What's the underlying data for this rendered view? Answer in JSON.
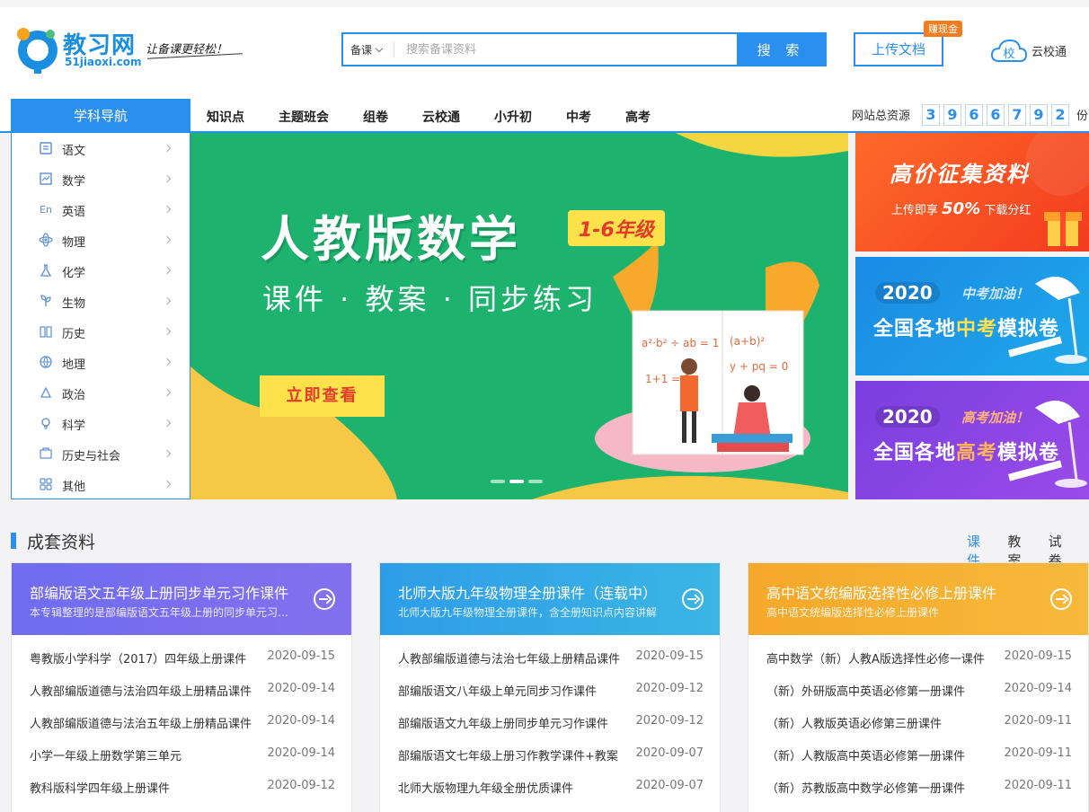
{
  "header": {
    "logo_text": "教习网",
    "logo_url": "51jiaoxi.com",
    "slogan": "让备课更轻松！",
    "search_category": "备课",
    "search_placeholder": "搜索备课资料",
    "search_button": "搜 索",
    "upload_label": "上传文档",
    "upload_badge": "赚现金",
    "cloud_icon_char": "校",
    "cloud_label": "云校通"
  },
  "nav": {
    "subject_nav": "学科导航",
    "items": [
      "知识点",
      "主题班会",
      "组卷",
      "云校通",
      "小升初",
      "中考",
      "高考"
    ],
    "total_label": "网站总资源",
    "total_digits": [
      "3",
      "9",
      "6",
      "6",
      "7",
      "9",
      "2"
    ],
    "total_unit": "份"
  },
  "sidebar": {
    "items": [
      {
        "label": "语文",
        "icon": "book-icon"
      },
      {
        "label": "数学",
        "icon": "math-icon"
      },
      {
        "label": "英语",
        "icon": "english-icon"
      },
      {
        "label": "物理",
        "icon": "atom-icon"
      },
      {
        "label": "化学",
        "icon": "flask-icon"
      },
      {
        "label": "生物",
        "icon": "plant-icon"
      },
      {
        "label": "历史",
        "icon": "history-icon"
      },
      {
        "label": "地理",
        "icon": "globe-icon"
      },
      {
        "label": "政治",
        "icon": "politics-icon"
      },
      {
        "label": "科学",
        "icon": "bulb-icon"
      },
      {
        "label": "历史与社会",
        "icon": "society-icon"
      },
      {
        "label": "其他",
        "icon": "grid-icon"
      }
    ]
  },
  "banner": {
    "title": "人教版数学",
    "tag": "1-6年级",
    "subtitle": "课件 · 教案 · 同步练习",
    "button": "立即查看",
    "board_text": [
      "a²·b² ÷ ab = 1",
      "(a+b)²",
      "1+1 = 2",
      "y + pq = 0"
    ],
    "colors": {
      "bg": "#1db36e",
      "accent": "#ffe14b"
    }
  },
  "promos": [
    {
      "title": "高价征集资料",
      "sub_prefix": "上传即享",
      "sub_value": "50%",
      "sub_suffix": "下载分红"
    },
    {
      "year": "2020",
      "cheer": "中考加油！",
      "main_prefix": "全国各地",
      "main_highlight": "中考",
      "main_suffix": "模拟卷"
    },
    {
      "year": "2020",
      "cheer": "高考加油！",
      "main_prefix": "全国各地",
      "main_highlight": "高考",
      "main_suffix": "模拟卷"
    }
  ],
  "section": {
    "title": "成套资料",
    "tabs": [
      "课件",
      "教案",
      "试卷"
    ]
  },
  "cards": [
    {
      "title": "部编版语文五年级上册同步单元习作课件",
      "desc": "本专辑整理的是部编版语文五年级上册的同步单元习作课件",
      "rows": [
        {
          "title": "粤教版小学科学（2017）四年级上册课件",
          "date": "2020-09-15"
        },
        {
          "title": "人教部编版道德与法治四年级上册精品课件",
          "date": "2020-09-14"
        },
        {
          "title": "人教部编版道德与法治五年级上册精品课件",
          "date": "2020-09-14"
        },
        {
          "title": "小学一年级上册数学第三单元",
          "date": "2020-09-14"
        },
        {
          "title": "教科版科学四年级上册课件",
          "date": "2020-09-12"
        }
      ]
    },
    {
      "title": "北师大版九年级物理全册课件（连载中）",
      "desc": "北师大版九年级物理全册课件，含全册知识点内容讲解",
      "rows": [
        {
          "title": "人教部编版道德与法治七年级上册精品课件",
          "date": "2020-09-15"
        },
        {
          "title": "部编版语文八年级上单元同步习作课件",
          "date": "2020-09-12"
        },
        {
          "title": "部编版语文九年级上册同步单元习作课件",
          "date": "2020-09-12"
        },
        {
          "title": "部编版语文七年级上册习作教学课件+教案",
          "date": "2020-09-07"
        },
        {
          "title": "北师大版物理九年级全册优质课件",
          "date": "2020-09-07"
        }
      ]
    },
    {
      "title": "高中语文统编版选择性必修上册课件",
      "desc": "高中语文统编版选择性必修上册课件",
      "rows": [
        {
          "title": "高中数学（新）人教A版选择性必修一课件",
          "date": "2020-09-15"
        },
        {
          "title": "（新）外研版高中英语必修第一册课件",
          "date": "2020-09-14"
        },
        {
          "title": "（新）人教版英语必修第三册课件",
          "date": "2020-09-11"
        },
        {
          "title": "（新）人教版高中英语必修第一册课件",
          "date": "2020-09-11"
        },
        {
          "title": "（新）苏教版高中数学必修第一册课件",
          "date": "2020-09-11"
        }
      ]
    }
  ]
}
